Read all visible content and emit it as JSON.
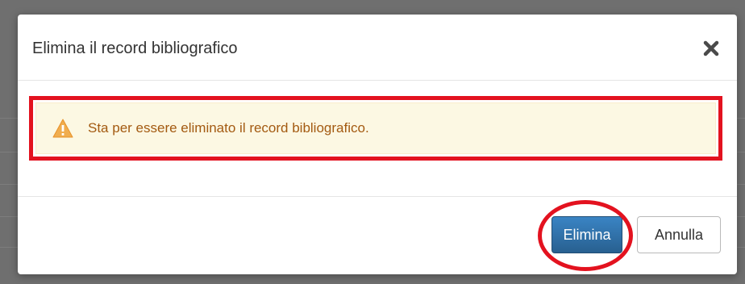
{
  "modal": {
    "title": "Elimina il record bibliografico",
    "close_icon": "close-icon"
  },
  "alert": {
    "icon": "warning-icon",
    "message": "Sta per essere eliminato il record bibliografico."
  },
  "footer": {
    "confirm_label": "Elimina",
    "cancel_label": "Annulla"
  },
  "colors": {
    "annotation_red": "#e3121f",
    "primary_blue": "#2e6da4",
    "warning_orange": "#f0ad4e",
    "warning_text": "#a35a11",
    "warning_bg": "#fcf8e3"
  }
}
